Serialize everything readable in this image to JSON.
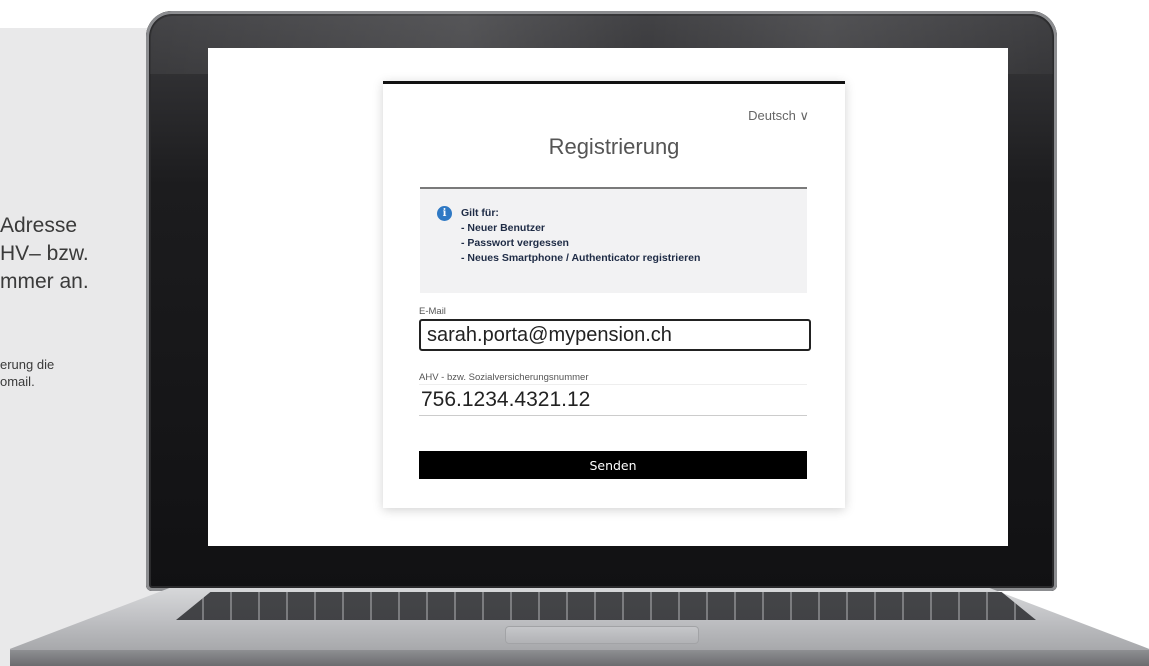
{
  "side": {
    "heading_lines": [
      "Adresse",
      "HV– bzw.",
      "mmer an."
    ],
    "note_lines": [
      "erung die",
      "omail."
    ]
  },
  "form": {
    "language": "Deutsch ∨",
    "title": "Registrierung",
    "info": {
      "icon": "info-icon",
      "lines": [
        "Gilt für:",
        "- Neuer Benutzer",
        "- Passwort vergessen",
        "- Neues Smartphone / Authenticator registrieren"
      ]
    },
    "email": {
      "label": "E-Mail",
      "value": "sarah.porta@mypension.ch"
    },
    "ahv": {
      "label": "AHV - bzw. Sozialversicherungsnummer",
      "value": "756.1234.4321.12"
    },
    "submit_label": "Senden"
  },
  "colors": {
    "accent": "#2f79c4",
    "button": "#000000",
    "panel": "#e9e9ea"
  }
}
